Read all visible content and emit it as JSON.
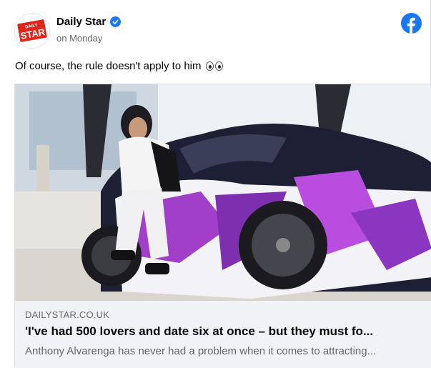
{
  "post": {
    "page_name": "Daily Star",
    "verified": true,
    "time": "on Monday",
    "text": "Of course, the rule doesn't apply to him",
    "emoji": "eyes",
    "platform_icon": "facebook-icon",
    "avatar_logo_text_top": "DAILY",
    "avatar_logo_text_bottom": "STAR",
    "colors": {
      "brand_red": "#e1251b",
      "facebook_blue": "#1877f2",
      "verified_blue": "#1877f2"
    }
  },
  "link_preview": {
    "domain": "DAILYSTAR.CO.UK",
    "headline": "'I've had 500 lovers and date six at once – but they must fo...",
    "description": "Anthony Alvarenga has never had a problem when it comes to attracting...",
    "image_subject": "man-sitting-on-wrapped-sports-car"
  }
}
